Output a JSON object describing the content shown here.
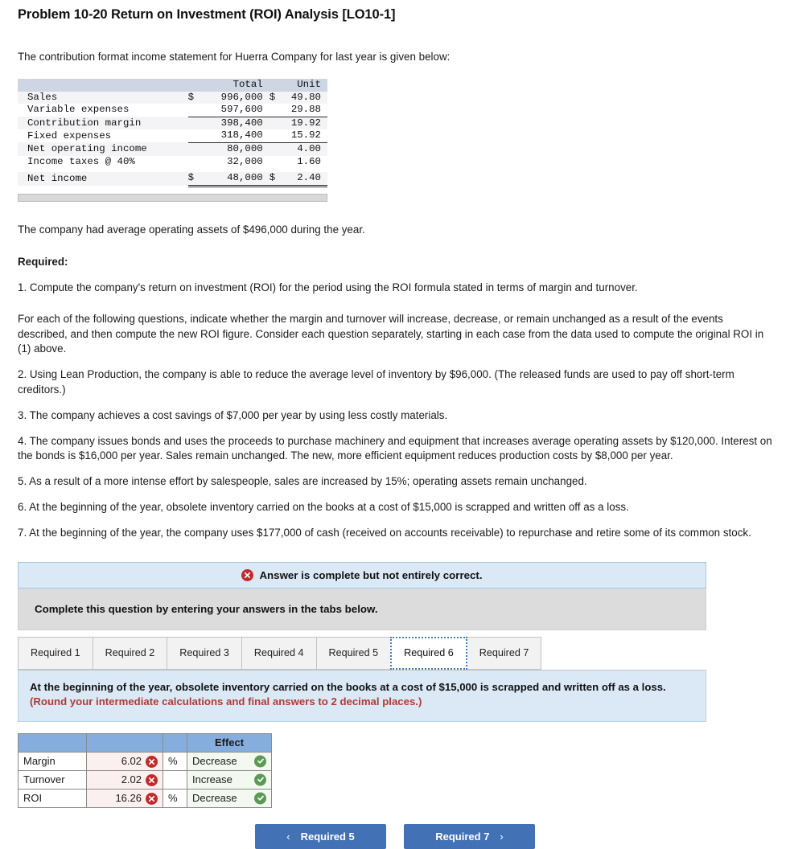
{
  "problem": {
    "title": "Problem 10-20 Return on Investment (ROI) Analysis [LO10-1]",
    "intro": "The contribution format income statement for Huerra Company for last year is given below:"
  },
  "income_statement": {
    "headers": {
      "blank": "",
      "total": "Total",
      "unit": "Unit"
    },
    "rows": [
      {
        "label": "Sales",
        "cur": "$",
        "total": "996,000",
        "cur2": "$",
        "unit": "49.80"
      },
      {
        "label": "Variable expenses",
        "cur": "",
        "total": "597,600",
        "cur2": "",
        "unit": "29.88"
      },
      {
        "label": "Contribution margin",
        "cur": "",
        "total": "398,400",
        "cur2": "",
        "unit": "19.92"
      },
      {
        "label": "Fixed expenses",
        "cur": "",
        "total": "318,400",
        "cur2": "",
        "unit": "15.92"
      },
      {
        "label": "Net operating income",
        "cur": "",
        "total": "80,000",
        "cur2": "",
        "unit": "4.00"
      },
      {
        "label": "Income taxes @ 40%",
        "cur": "",
        "total": "32,000",
        "cur2": "",
        "unit": "1.60"
      },
      {
        "label": "Net income",
        "cur": "$",
        "total": "48,000",
        "cur2": "$",
        "unit": "2.40"
      }
    ]
  },
  "body": {
    "assets": "The company had average operating assets of $496,000 during the year.",
    "required_label": "Required:",
    "req1": "1. Compute the company's return on investment (ROI) for the period using the ROI formula stated in terms of margin and turnover.",
    "lead_in": "For each of the following questions, indicate whether the margin and turnover will increase, decrease, or remain unchanged as a result of the events described, and then compute the new ROI figure. Consider each question separately, starting in each case from the data used to compute the original ROI in (1) above.",
    "req2": "2. Using Lean Production, the company is able to reduce the average level of inventory by $96,000. (The released funds are used to pay off short-term creditors.)",
    "req3": "3. The company achieves a cost savings of $7,000 per year by using less costly materials.",
    "req4": "4. The company issues bonds and uses the proceeds to purchase machinery and equipment that increases average operating assets by $120,000. Interest on the bonds is $16,000 per year. Sales remain unchanged. The new, more efficient equipment reduces production costs by $8,000 per year.",
    "req5": "5. As a result of a more intense effort by salespeople, sales are increased by 15%; operating assets remain unchanged.",
    "req6": "6. At the beginning of the year, obsolete inventory carried on the books at a cost of $15,000 is scrapped and written off as a loss.",
    "req7": "7. At the beginning of the year, the company uses $177,000 of cash (received on accounts receivable) to repurchase and retire some of its common stock."
  },
  "alert": {
    "icon": "error-circle-icon",
    "message": "Answer is complete but not entirely correct."
  },
  "instruction_bar": {
    "text": "Complete this question by entering your answers in the tabs below."
  },
  "tabs": {
    "items": [
      {
        "label": "Required 1",
        "active": false
      },
      {
        "label": "Required 2",
        "active": false
      },
      {
        "label": "Required 3",
        "active": false
      },
      {
        "label": "Required 4",
        "active": false
      },
      {
        "label": "Required 5",
        "active": false
      },
      {
        "label": "Required 6",
        "active": true
      },
      {
        "label": "Required 7",
        "active": false
      }
    ]
  },
  "question_panel": {
    "text": "At the beginning of the year, obsolete inventory carried on the books at a cost of $15,000 is scrapped and written off as a loss. ",
    "round_note": "(Round your intermediate calculations and final answers to 2 decimal places.)"
  },
  "answer_table": {
    "headers": {
      "name": "",
      "value": "",
      "pct": "",
      "effect": "Effect"
    },
    "rows": [
      {
        "name": "Margin",
        "value": "6.02",
        "value_status": "incorrect",
        "pct": "%",
        "effect": "Decrease",
        "effect_status": "correct"
      },
      {
        "name": "Turnover",
        "value": "2.02",
        "value_status": "incorrect",
        "pct": "",
        "effect": "Increase",
        "effect_status": "correct"
      },
      {
        "name": "ROI",
        "value": "16.26",
        "value_status": "incorrect",
        "pct": "%",
        "effect": "Decrease",
        "effect_status": "correct"
      }
    ]
  },
  "navigation": {
    "prev_label": "Required 5",
    "next_label": "Required 7",
    "prev_chevron": "‹",
    "next_chevron": "›"
  },
  "colors": {
    "accent_blue": "#4271b5",
    "table_header_blue": "#85aede",
    "alert_bg": "#dbe9f6",
    "error_red": "#c32b2b",
    "success_green": "#5b9a54",
    "note_red": "#b03a32"
  }
}
